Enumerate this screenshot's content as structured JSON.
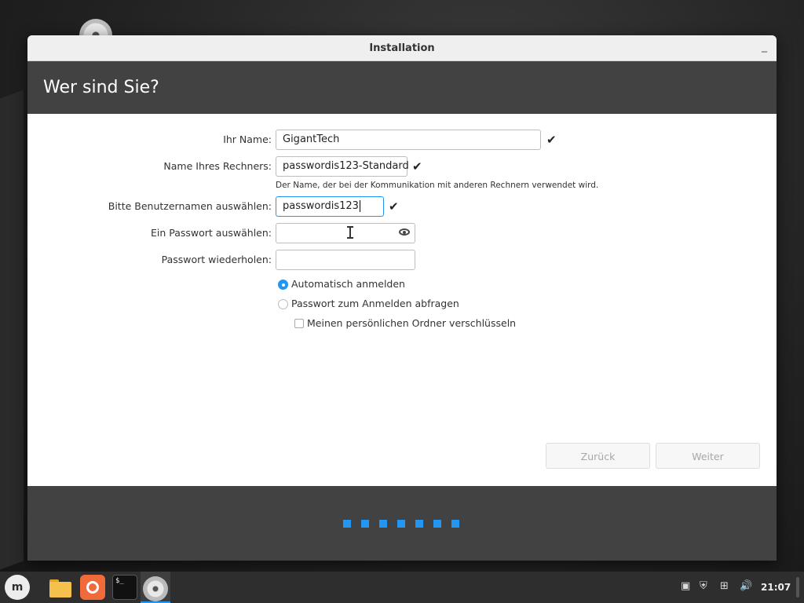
{
  "window": {
    "title": "Installation",
    "minimize_glyph": "_"
  },
  "page_heading": "Wer sind Sie?",
  "form": {
    "name_label": "Ihr Name:",
    "name_value": "GigantTech",
    "computer_label": "Name Ihres Rechners:",
    "computer_value": "passwordis123-Standard",
    "computer_hint": "Der Name, der bei der Kommunikation mit anderen Rechnern verwendet wird.",
    "username_label": "Bitte Benutzernamen auswählen:",
    "username_value": "passwordis123",
    "password_label": "Ein Passwort auswählen:",
    "password_value": "",
    "password_repeat_label": "Passwort wiederholen:",
    "password_repeat_value": "",
    "valid_glyph": "✔"
  },
  "login_options": {
    "auto_login_label": "Automatisch anmelden",
    "auto_login_selected": true,
    "ask_password_label": "Passwort zum Anmelden abfragen",
    "ask_password_selected": false,
    "encrypt_home_label": "Meinen persönlichen Ordner verschlüsseln",
    "encrypt_home_checked": false
  },
  "buttons": {
    "back": "Zurück",
    "next": "Weiter"
  },
  "progress": {
    "total_steps": 7
  },
  "taskbar": {
    "clock": "21:07",
    "items": [
      "mint-menu-icon",
      "files-icon",
      "firefox-icon",
      "terminal-icon",
      "installer-disc-icon"
    ],
    "terminal_glyph": "$_",
    "menu_glyph": "m",
    "tray_icons": [
      "clipboard-icon",
      "shield-icon",
      "network-icon",
      "volume-icon"
    ]
  },
  "colors": {
    "accent": "#2196f3",
    "header_bg": "#424242",
    "panel_bg": "#2e2e2e"
  }
}
